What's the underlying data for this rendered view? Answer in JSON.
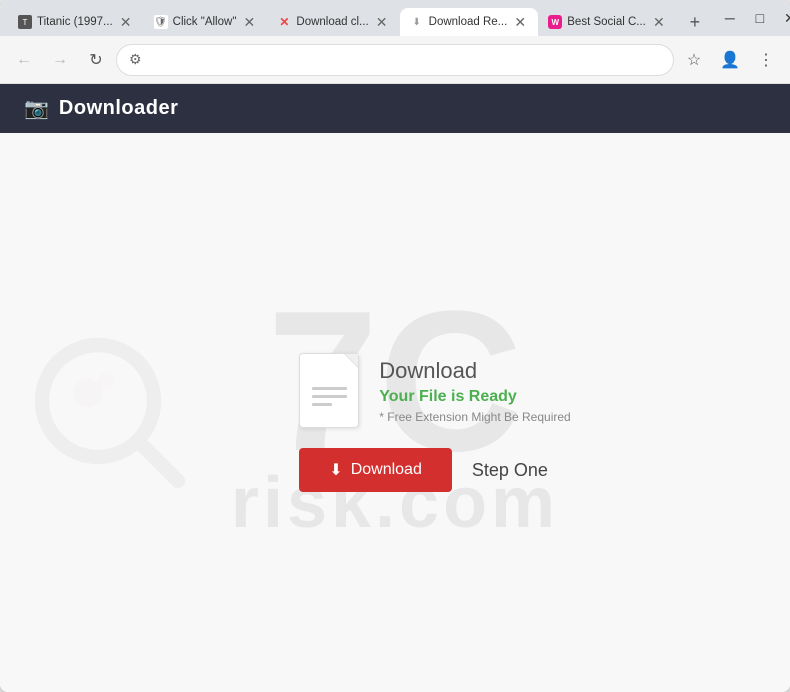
{
  "browser": {
    "tabs": [
      {
        "id": "titanic",
        "label": "Titanic (1997...",
        "favicon_type": "titanic",
        "favicon_text": "T",
        "active": false
      },
      {
        "id": "allow",
        "label": "Click \"Allow\"",
        "favicon_type": "allow",
        "favicon_text": "🛡",
        "active": false
      },
      {
        "id": "download-closed",
        "label": "Download cl...",
        "favicon_type": "download-x",
        "favicon_text": "✕",
        "active": false
      },
      {
        "id": "download-active",
        "label": "Download Re...",
        "favicon_type": "download-active",
        "favicon_text": "⬇",
        "active": true
      },
      {
        "id": "social",
        "label": "Best Social C...",
        "favicon_type": "social",
        "favicon_text": "W",
        "active": false
      }
    ],
    "new_tab_btn": "+",
    "window_controls": {
      "minimize": "─",
      "maximize": "□",
      "close": "✕"
    },
    "nav": {
      "back": "←",
      "forward": "→",
      "reload": "↻",
      "address_icon": "⚙",
      "address_url": "",
      "bookmark": "☆",
      "profile": "👤",
      "menu": "⋮"
    }
  },
  "app_header": {
    "icon": "📷",
    "title": "Downloader"
  },
  "watermark": {
    "letters": "7C",
    "text": "risk.com"
  },
  "download_section": {
    "title": "Download",
    "ready_text": "Your File is Ready",
    "note_text": "* Free Extension Might Be Required",
    "download_btn_label": "Download",
    "step_label": "Step One"
  }
}
